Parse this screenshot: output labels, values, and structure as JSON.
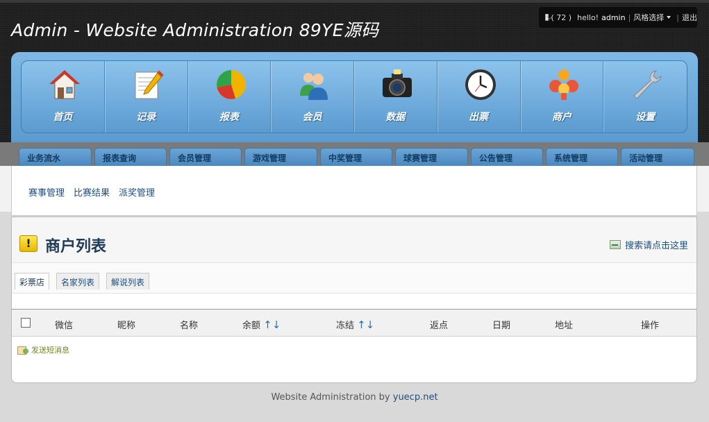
{
  "header": {
    "title": "Admin - Website Administration 89YE源码",
    "message_count": "( 72 )",
    "greeting": "hello!",
    "username": "admin",
    "style_select": "风格选择",
    "logout": "退出"
  },
  "icons": [
    {
      "label": "首页",
      "icon": "home-icon"
    },
    {
      "label": "记录",
      "icon": "notepad-icon"
    },
    {
      "label": "报表",
      "icon": "pie-chart-icon"
    },
    {
      "label": "会员",
      "icon": "users-icon"
    },
    {
      "label": "数据",
      "icon": "camera-icon"
    },
    {
      "label": "出票",
      "icon": "clock-icon"
    },
    {
      "label": "商户",
      "icon": "merchant-icon"
    },
    {
      "label": "设置",
      "icon": "wrench-icon"
    }
  ],
  "tabs": [
    "业务流水",
    "报表查询",
    "会员管理",
    "游戏管理",
    "中奖管理",
    "球赛管理",
    "公告管理",
    "系统管理",
    "活动管理"
  ],
  "subnav": [
    "赛事管理",
    "比赛结果",
    "派奖管理"
  ],
  "page": {
    "title": "商户列表",
    "search_link": "搜索请点击这里"
  },
  "subtabs": [
    "彩票店",
    "名家列表",
    "解说列表"
  ],
  "table": {
    "columns": [
      "微信",
      "昵称",
      "名称",
      "余额",
      "冻结",
      "返点",
      "日期",
      "地址",
      "操作"
    ],
    "sort_arrows": "↑↓"
  },
  "actions": {
    "send_message": "发送短消息"
  },
  "footer": {
    "text": "Website Administration by",
    "link": "yuecp.net"
  },
  "colors": {
    "tab_blue": "#4a88c1",
    "panel_blue": "#5b9ad0",
    "header_dark": "#1e1e1e",
    "title_navy": "#1f3b57"
  }
}
